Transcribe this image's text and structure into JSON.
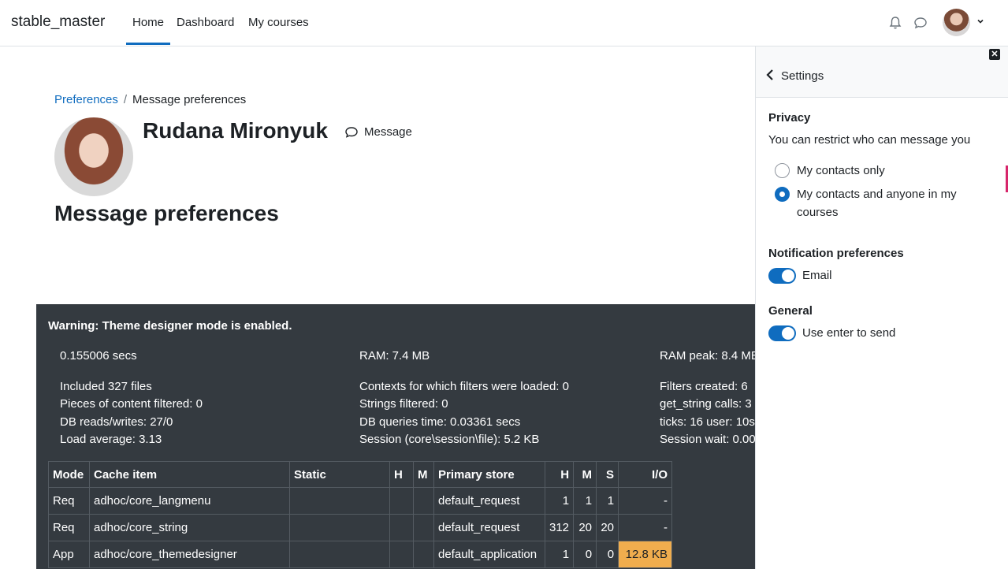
{
  "navbar": {
    "brand": "stable_master",
    "links": [
      "Home",
      "Dashboard",
      "My courses"
    ],
    "active": "Home",
    "icons": [
      "bell-icon",
      "chat-icon",
      "user-avatar",
      "chevron-down-icon"
    ]
  },
  "breadcrumb": {
    "parent": "Preferences",
    "separator": "/",
    "current": "Message preferences"
  },
  "profile": {
    "name": "Rudana Mironyuk",
    "message_label": "Message"
  },
  "page": {
    "title": "Message preferences"
  },
  "perf": {
    "warning": "Warning: Theme designer mode is enabled.",
    "col1": [
      "0.155006 secs",
      "Included 327 files",
      "Pieces of content filtered: 0",
      "DB reads/writes: 27/0",
      "Load average: 3.13"
    ],
    "col2": [
      "RAM: 7.4 MB",
      "Contexts for which filters were loaded: 0",
      "Strings filtered: 0",
      "DB queries time: 0.03361 secs",
      "Session (core\\session\\file): 5.2 KB"
    ],
    "col3": [
      "RAM peak: 8.4 MB",
      "Filters created: 6",
      "get_string calls: 3",
      "ticks: 16 user: 10s",
      "Session wait: 0.00"
    ],
    "cache_headers": [
      "Mode",
      "Cache item",
      "Static",
      "H",
      "M",
      "Primary store",
      "H",
      "M",
      "S",
      "I/O"
    ],
    "cache_rows": [
      [
        "Req",
        "adhoc/core_langmenu",
        "",
        "",
        "",
        "default_request",
        "1",
        "1",
        "1",
        "-"
      ],
      [
        "Req",
        "adhoc/core_string",
        "",
        "",
        "",
        "default_request",
        "312",
        "20",
        "20",
        "-"
      ],
      [
        "App",
        "adhoc/core_themedesigner",
        "",
        "",
        "",
        "default_application",
        "1",
        "0",
        "0",
        "12.8 KB"
      ]
    ],
    "highlight_color": "#f0ad4e"
  },
  "drawer": {
    "title": "Settings",
    "privacy": {
      "heading": "Privacy",
      "description": "You can restrict who can message you",
      "options": [
        "My contacts only",
        "My contacts and anyone in my",
        "courses"
      ],
      "selected": "My contacts and anyone in my courses"
    },
    "notifications": {
      "heading": "Notification preferences",
      "email_label": "Email",
      "email_on": true
    },
    "general": {
      "heading": "General",
      "enter_label": "Use enter to send",
      "enter_on": true
    }
  },
  "colors": {
    "accent": "#0f6cbf",
    "footer_bg": "#343a40"
  }
}
